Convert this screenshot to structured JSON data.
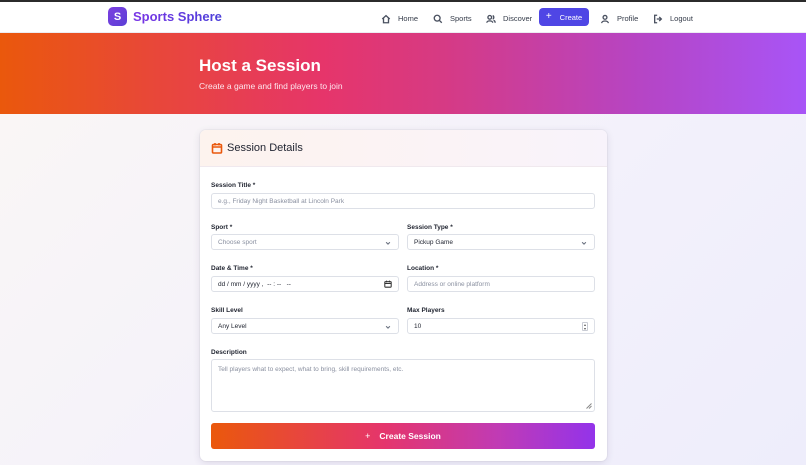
{
  "brand": {
    "logo_letter": "S",
    "name": "Sports Sphere"
  },
  "nav": {
    "home": "Home",
    "sports": "Sports",
    "discover": "Discover",
    "create": "Create",
    "profile": "Profile",
    "logout": "Logout"
  },
  "hero": {
    "title": "Host a Session",
    "subtitle": "Create a game and find players to join"
  },
  "form": {
    "header": "Session Details",
    "title_label": "Session Title *",
    "title_placeholder": "e.g., Friday Night Basketball at Lincoln Park",
    "sport_label": "Sport *",
    "sport_value": "Choose sport",
    "type_label": "Session Type *",
    "type_value": "Pickup Game",
    "datetime_label": "Date & Time *",
    "datetime_value": "dd / mm / yyyy ,  -- : --   --",
    "location_label": "Location *",
    "location_placeholder": "Address or online platform",
    "skill_label": "Skill Level",
    "skill_value": "Any Level",
    "max_label": "Max Players",
    "max_value": "10",
    "description_label": "Description",
    "description_placeholder": "Tell players what to expect, what to bring, skill requirements, etc.",
    "submit": "Create Session"
  },
  "colors": {
    "brand": "#4f46e5",
    "hero_start": "#ea580c",
    "hero_end": "#a855f7",
    "accent_icon": "#ea580c"
  },
  "icons": [
    "home-icon",
    "search-icon",
    "users-icon",
    "plus-icon",
    "user-icon",
    "logout-icon",
    "calendar-icon",
    "chevron-down-icon"
  ]
}
